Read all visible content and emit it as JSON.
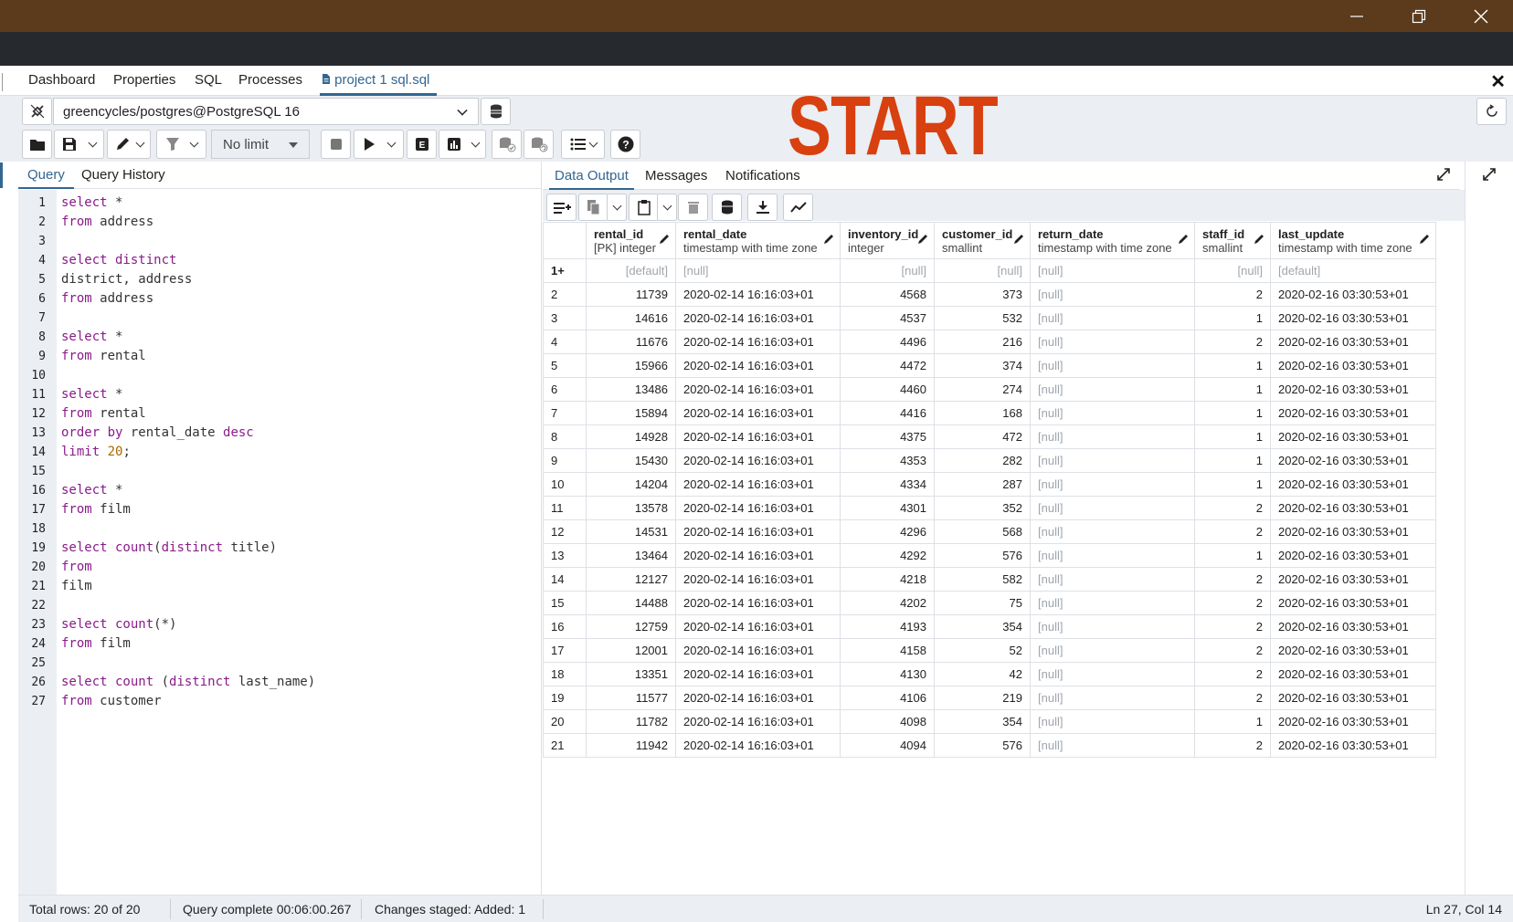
{
  "window": {
    "minimize": "—",
    "restore": "❐",
    "close": "✕"
  },
  "tabs": [
    {
      "label": "Dashboard"
    },
    {
      "label": "Properties"
    },
    {
      "label": "SQL"
    },
    {
      "label": "Processes"
    },
    {
      "label": "project 1 sql.sql",
      "active": true
    }
  ],
  "connection": {
    "value": "greencycles/postgres@PostgreSQL 16"
  },
  "toolbar": {
    "limit": "No limit"
  },
  "overlay_text": "START",
  "query_panel": {
    "tabs": [
      {
        "label": "Query",
        "active": true
      },
      {
        "label": "Query History"
      }
    ],
    "lines": [
      "1",
      "2",
      "3",
      "4",
      "5",
      "6",
      "7",
      "8",
      "9",
      "10",
      "11",
      "12",
      "13",
      "14",
      "15",
      "16",
      "17",
      "18",
      "19",
      "20",
      "21",
      "22",
      "23",
      "24",
      "25",
      "26",
      "27"
    ]
  },
  "data_panel": {
    "tabs": [
      {
        "label": "Data Output",
        "active": true
      },
      {
        "label": "Messages"
      },
      {
        "label": "Notifications"
      }
    ],
    "columns": [
      {
        "name": "rental_id",
        "type": "[PK] integer"
      },
      {
        "name": "rental_date",
        "type": "timestamp with time zone"
      },
      {
        "name": "inventory_id",
        "type": "integer"
      },
      {
        "name": "customer_id",
        "type": "smallint"
      },
      {
        "name": "return_date",
        "type": "timestamp with time zone"
      },
      {
        "name": "staff_id",
        "type": "smallint"
      },
      {
        "name": "last_update",
        "type": "timestamp with time zone"
      }
    ],
    "new_row": {
      "num": "1+",
      "rental_id": "[default]",
      "rental_date": "[null]",
      "inventory_id": "[null]",
      "customer_id": "[null]",
      "return_date": "[null]",
      "staff_id": "[null]",
      "last_update": "[default]"
    },
    "rows": [
      {
        "num": "2",
        "rental_id": "11739",
        "rental_date": "2020-02-14 16:16:03+01",
        "inventory_id": "4568",
        "customer_id": "373",
        "return_date": "[null]",
        "staff_id": "2",
        "last_update": "2020-02-16 03:30:53+01"
      },
      {
        "num": "3",
        "rental_id": "14616",
        "rental_date": "2020-02-14 16:16:03+01",
        "inventory_id": "4537",
        "customer_id": "532",
        "return_date": "[null]",
        "staff_id": "1",
        "last_update": "2020-02-16 03:30:53+01"
      },
      {
        "num": "4",
        "rental_id": "11676",
        "rental_date": "2020-02-14 16:16:03+01",
        "inventory_id": "4496",
        "customer_id": "216",
        "return_date": "[null]",
        "staff_id": "2",
        "last_update": "2020-02-16 03:30:53+01"
      },
      {
        "num": "5",
        "rental_id": "15966",
        "rental_date": "2020-02-14 16:16:03+01",
        "inventory_id": "4472",
        "customer_id": "374",
        "return_date": "[null]",
        "staff_id": "1",
        "last_update": "2020-02-16 03:30:53+01"
      },
      {
        "num": "6",
        "rental_id": "13486",
        "rental_date": "2020-02-14 16:16:03+01",
        "inventory_id": "4460",
        "customer_id": "274",
        "return_date": "[null]",
        "staff_id": "1",
        "last_update": "2020-02-16 03:30:53+01"
      },
      {
        "num": "7",
        "rental_id": "15894",
        "rental_date": "2020-02-14 16:16:03+01",
        "inventory_id": "4416",
        "customer_id": "168",
        "return_date": "[null]",
        "staff_id": "1",
        "last_update": "2020-02-16 03:30:53+01"
      },
      {
        "num": "8",
        "rental_id": "14928",
        "rental_date": "2020-02-14 16:16:03+01",
        "inventory_id": "4375",
        "customer_id": "472",
        "return_date": "[null]",
        "staff_id": "1",
        "last_update": "2020-02-16 03:30:53+01"
      },
      {
        "num": "9",
        "rental_id": "15430",
        "rental_date": "2020-02-14 16:16:03+01",
        "inventory_id": "4353",
        "customer_id": "282",
        "return_date": "[null]",
        "staff_id": "1",
        "last_update": "2020-02-16 03:30:53+01"
      },
      {
        "num": "10",
        "rental_id": "14204",
        "rental_date": "2020-02-14 16:16:03+01",
        "inventory_id": "4334",
        "customer_id": "287",
        "return_date": "[null]",
        "staff_id": "1",
        "last_update": "2020-02-16 03:30:53+01"
      },
      {
        "num": "11",
        "rental_id": "13578",
        "rental_date": "2020-02-14 16:16:03+01",
        "inventory_id": "4301",
        "customer_id": "352",
        "return_date": "[null]",
        "staff_id": "2",
        "last_update": "2020-02-16 03:30:53+01"
      },
      {
        "num": "12",
        "rental_id": "14531",
        "rental_date": "2020-02-14 16:16:03+01",
        "inventory_id": "4296",
        "customer_id": "568",
        "return_date": "[null]",
        "staff_id": "2",
        "last_update": "2020-02-16 03:30:53+01"
      },
      {
        "num": "13",
        "rental_id": "13464",
        "rental_date": "2020-02-14 16:16:03+01",
        "inventory_id": "4292",
        "customer_id": "576",
        "return_date": "[null]",
        "staff_id": "1",
        "last_update": "2020-02-16 03:30:53+01"
      },
      {
        "num": "14",
        "rental_id": "12127",
        "rental_date": "2020-02-14 16:16:03+01",
        "inventory_id": "4218",
        "customer_id": "582",
        "return_date": "[null]",
        "staff_id": "2",
        "last_update": "2020-02-16 03:30:53+01"
      },
      {
        "num": "15",
        "rental_id": "14488",
        "rental_date": "2020-02-14 16:16:03+01",
        "inventory_id": "4202",
        "customer_id": "75",
        "return_date": "[null]",
        "staff_id": "2",
        "last_update": "2020-02-16 03:30:53+01"
      },
      {
        "num": "16",
        "rental_id": "12759",
        "rental_date": "2020-02-14 16:16:03+01",
        "inventory_id": "4193",
        "customer_id": "354",
        "return_date": "[null]",
        "staff_id": "2",
        "last_update": "2020-02-16 03:30:53+01"
      },
      {
        "num": "17",
        "rental_id": "12001",
        "rental_date": "2020-02-14 16:16:03+01",
        "inventory_id": "4158",
        "customer_id": "52",
        "return_date": "[null]",
        "staff_id": "2",
        "last_update": "2020-02-16 03:30:53+01"
      },
      {
        "num": "18",
        "rental_id": "13351",
        "rental_date": "2020-02-14 16:16:03+01",
        "inventory_id": "4130",
        "customer_id": "42",
        "return_date": "[null]",
        "staff_id": "2",
        "last_update": "2020-02-16 03:30:53+01"
      },
      {
        "num": "19",
        "rental_id": "11577",
        "rental_date": "2020-02-14 16:16:03+01",
        "inventory_id": "4106",
        "customer_id": "219",
        "return_date": "[null]",
        "staff_id": "2",
        "last_update": "2020-02-16 03:30:53+01"
      },
      {
        "num": "20",
        "rental_id": "11782",
        "rental_date": "2020-02-14 16:16:03+01",
        "inventory_id": "4098",
        "customer_id": "354",
        "return_date": "[null]",
        "staff_id": "1",
        "last_update": "2020-02-16 03:30:53+01"
      },
      {
        "num": "21",
        "rental_id": "11942",
        "rental_date": "2020-02-14 16:16:03+01",
        "inventory_id": "4094",
        "customer_id": "576",
        "return_date": "[null]",
        "staff_id": "2",
        "last_update": "2020-02-16 03:30:53+01"
      }
    ]
  },
  "status": {
    "total_rows": "Total rows: 20 of 20",
    "query_complete": "Query complete 00:06:00.267",
    "changes": "Changes staged: Added: 1",
    "cursor": "Ln 27, Col 14"
  },
  "colors": {
    "accent": "#326690",
    "titlebar": "#5b3b1c",
    "overlay": "#d8400f",
    "keyword": "#8a1b8a"
  }
}
